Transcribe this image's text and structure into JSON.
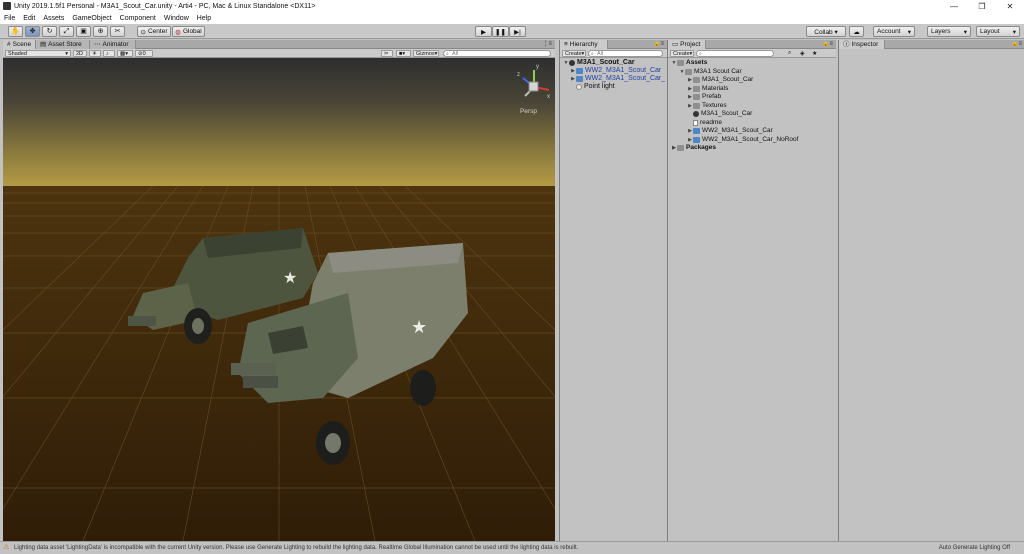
{
  "window": {
    "title": "Unity 2019.1.5f1 Personal - M3A1_Scout_Car.unity - Arti4 - PC, Mac & Linux Standalone <DX11>",
    "minimize": "—",
    "maximize": "❐",
    "close": "✕"
  },
  "menu": [
    "File",
    "Edit",
    "Assets",
    "GameObject",
    "Component",
    "Window",
    "Help"
  ],
  "toolbar": {
    "center_label": "Center",
    "global_label": "Global",
    "collab_label": "Collab ▾",
    "account_label": "Account",
    "layers_label": "Layers",
    "layout_label": "Layout"
  },
  "scene_panel": {
    "tabs": [
      "Scene",
      "Asset Store",
      "Animator"
    ],
    "shading_mode": "Shaded",
    "mode_2d": "2D",
    "fx_count": "0",
    "gizmos_label": "Gizmos",
    "search_placeholder": "All",
    "persp_label": "Persp",
    "gizmo_axes": {
      "x": "x",
      "y": "y",
      "z": "z"
    }
  },
  "hierarchy": {
    "tab": "Hierarchy",
    "create_label": "Create",
    "search_placeholder": "All",
    "scene_name": "M3A1_Scout_Car",
    "items": [
      {
        "label": "WW2_M3A1_Scout_Car",
        "icon": "prefab-cube-icon",
        "expandable": true
      },
      {
        "label": "WW2_M3A1_Scout_Car_",
        "icon": "prefab-cube-icon",
        "expandable": true
      },
      {
        "label": "Point light",
        "icon": "light-icon",
        "expandable": false
      }
    ]
  },
  "project": {
    "tab": "Project",
    "create_label": "Create",
    "items": [
      {
        "label": "Assets",
        "bold": true,
        "indent": 0,
        "icon": "folder-icon",
        "arrow": "▼"
      },
      {
        "label": "M3A1 Scout Car",
        "bold": false,
        "indent": 1,
        "icon": "folder-icon",
        "arrow": "▼"
      },
      {
        "label": "M3A1_Scout_Car",
        "bold": false,
        "indent": 2,
        "icon": "folder-icon",
        "arrow": "▶"
      },
      {
        "label": "Materials",
        "bold": false,
        "indent": 2,
        "icon": "folder-icon",
        "arrow": "▶"
      },
      {
        "label": "Prefab",
        "bold": false,
        "indent": 2,
        "icon": "folder-icon",
        "arrow": "▶"
      },
      {
        "label": "Textures",
        "bold": false,
        "indent": 2,
        "icon": "folder-icon",
        "arrow": "▶"
      },
      {
        "label": "M3A1_Scout_Car",
        "bold": false,
        "indent": 2,
        "icon": "unity-scene-icon",
        "arrow": ""
      },
      {
        "label": "readme",
        "bold": false,
        "indent": 2,
        "icon": "document-icon",
        "arrow": ""
      },
      {
        "label": "WW2_M3A1_Scout_Car",
        "bold": false,
        "indent": 2,
        "icon": "prefab-cube-icon",
        "arrow": "▶"
      },
      {
        "label": "WW2_M3A1_Scout_Car_NoRoof",
        "bold": false,
        "indent": 2,
        "icon": "prefab-cube-icon",
        "arrow": "▶"
      },
      {
        "label": "Packages",
        "bold": true,
        "indent": 0,
        "icon": "folder-icon",
        "arrow": "▶"
      }
    ]
  },
  "inspector": {
    "tab": "Inspector"
  },
  "status": {
    "message": "Lighting data asset 'LightingData' is incompatible with the current Unity version. Please use Generate Lighting to rebuild the lighting data.  Realtime Global Illumination cannot be used until the lighting data is rebuilt.",
    "right": "Auto Generate Lighting Off"
  },
  "colors": {
    "accent": "#4f86c7",
    "panel_bg": "#c2c2c2",
    "prefab_text": "#1f3fa6"
  }
}
